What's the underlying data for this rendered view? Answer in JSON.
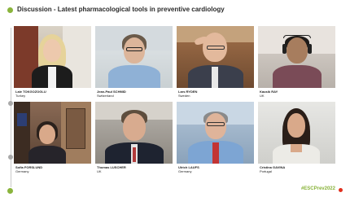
{
  "header": {
    "title": "Discussion - Latest pharmacological tools in preventive cardiology"
  },
  "participants": [
    {
      "name": "Lale TOKGOZOGLU",
      "country": "Turkey"
    },
    {
      "name": "Jean-Paul SCHMID",
      "country": "Switzerland"
    },
    {
      "name": "Lars RYDEN",
      "country": "Sweden"
    },
    {
      "name": "Kausik RAY",
      "country": "UK"
    },
    {
      "name": "Sofia FORSLUND",
      "country": "Germany"
    },
    {
      "name": "Thomas LUSCHER",
      "country": "UK"
    },
    {
      "name": "Ulrich LAUFS",
      "country": "Germany"
    },
    {
      "name": "Cristina GAVINA",
      "country": "Portugal"
    }
  ],
  "footer": {
    "hashtag": "#ESCPrev2022"
  },
  "colors": {
    "accent_green": "#8ab43c",
    "live_red": "#e0301e"
  }
}
